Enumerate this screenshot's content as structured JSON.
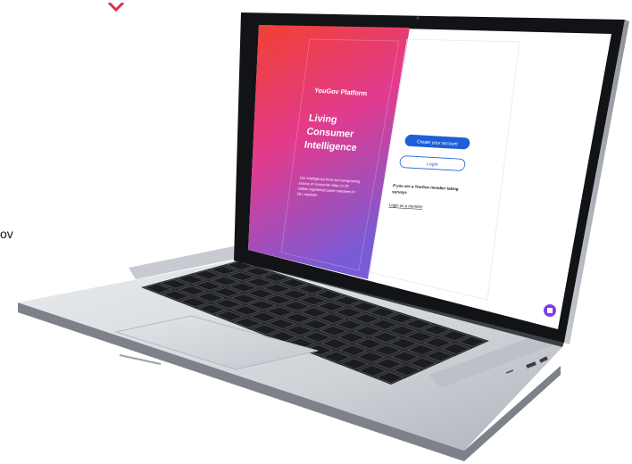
{
  "page": {
    "side_text": "ov"
  },
  "screen": {
    "brand": "YouGov Platform",
    "headline_1": "Living",
    "headline_2": "Consumer",
    "headline_3": "Intelligence",
    "description_1": "Our intelligence from our evergrowing",
    "description_2": "source of consumer data on 20",
    "description_3": "million registered panel members in",
    "description_4": "55+ markets.",
    "create_account_label": "Create your account",
    "login_label": "Login",
    "member_text_1": "If you are a YouGov member taking",
    "member_text_2": "surveys",
    "member_link": "Login as a member"
  },
  "colors": {
    "gradient_top": "#f2412e",
    "gradient_mid": "#e13b8f",
    "gradient_bottom": "#7a5bd6",
    "primary_button": "#1d5fd6",
    "chat_widget": "#7b3fe4",
    "logo_accent": "#e0304f"
  }
}
